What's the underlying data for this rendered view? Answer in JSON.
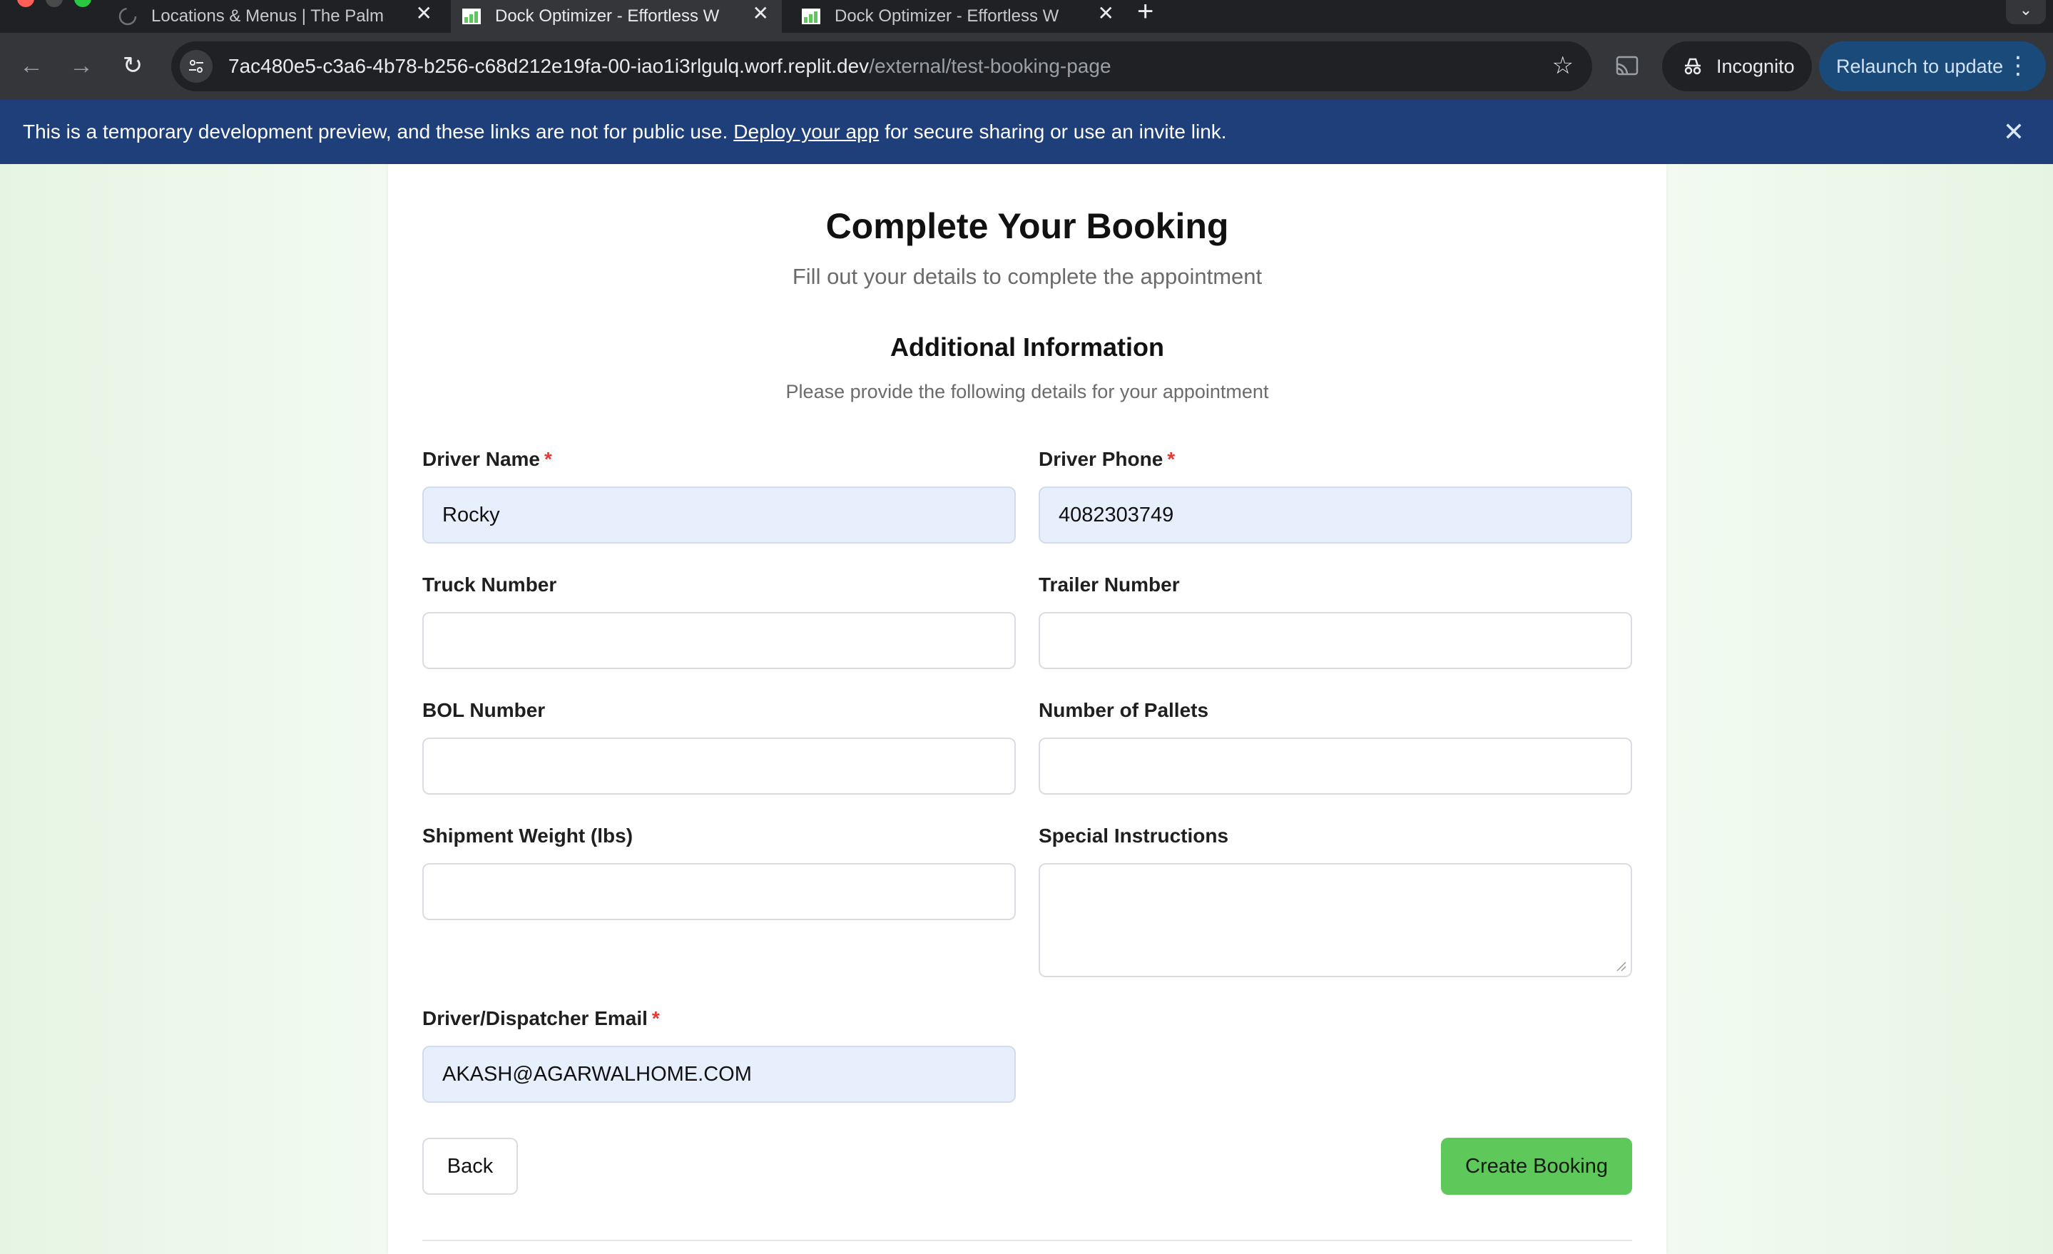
{
  "browser": {
    "tabs": [
      {
        "title": "Locations & Menus | The Palm",
        "active": false
      },
      {
        "title": "Dock Optimizer - Effortless W",
        "active": true
      },
      {
        "title": "Dock Optimizer - Effortless W",
        "active": false
      }
    ],
    "url_host": "7ac480e5-c3a6-4b78-b256-c68d212e19fa-00-iao1i3rlgulq.worf.replit.dev",
    "url_path": "/external/test-booking-page",
    "incognito_label": "Incognito",
    "relaunch_label": "Relaunch to update"
  },
  "banner": {
    "text_before": "This is a temporary development preview, and these links are not for public use.",
    "link_text": "Deploy your app",
    "text_after": "for secure sharing or use an invite link."
  },
  "form": {
    "title": "Complete Your Booking",
    "subtitle": "Fill out your details to complete the appointment",
    "section_title": "Additional Information",
    "section_subtitle": "Please provide the following details for your appointment",
    "required_mark": "*",
    "fields": {
      "driver_name": {
        "label": "Driver Name",
        "value": "Rocky"
      },
      "driver_phone": {
        "label": "Driver Phone",
        "value": "4082303749"
      },
      "truck_number": {
        "label": "Truck Number",
        "value": ""
      },
      "trailer_number": {
        "label": "Trailer Number",
        "value": ""
      },
      "bol_number": {
        "label": "BOL Number",
        "value": ""
      },
      "number_of_pallets": {
        "label": "Number of Pallets",
        "value": ""
      },
      "shipment_weight": {
        "label": "Shipment Weight (lbs)",
        "value": ""
      },
      "special_instructions": {
        "label": "Special Instructions",
        "value": ""
      },
      "email": {
        "label": "Driver/Dispatcher Email",
        "value": "AKASH@AGARWALHOME.COM"
      }
    },
    "back_label": "Back",
    "create_label": "Create Booking"
  },
  "colors": {
    "primary_button": "#5ec85a",
    "banner_bg": "#1e3f7a",
    "autofill_bg": "#e8effc",
    "required": "#e53935"
  }
}
